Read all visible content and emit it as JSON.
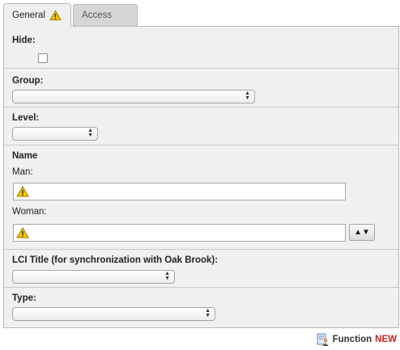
{
  "tabs": [
    {
      "label": "General",
      "active": true,
      "warning": true
    },
    {
      "label": "Access",
      "active": false
    }
  ],
  "form": {
    "hide_label": "Hide:",
    "hide_checked": false,
    "group_label": "Group:",
    "group_value": "",
    "level_label": "Level:",
    "level_value": "",
    "name_label": "Name",
    "man_label": "Man:",
    "man_value": "",
    "woman_label": "Woman:",
    "woman_value": "",
    "sort_button": "▲▼",
    "lci_label": "LCI Title (for synchronization with Oak Brook):",
    "lci_value": "",
    "type_label": "Type:",
    "type_value": ""
  },
  "footer": {
    "function_label": "Function",
    "badge": "NEW"
  },
  "colors": {
    "warning_fill": "#f5c400",
    "new_badge": "#c62222"
  },
  "icons": [
    "warning-icon",
    "function-user-icon",
    "select-arrows-icon"
  ]
}
